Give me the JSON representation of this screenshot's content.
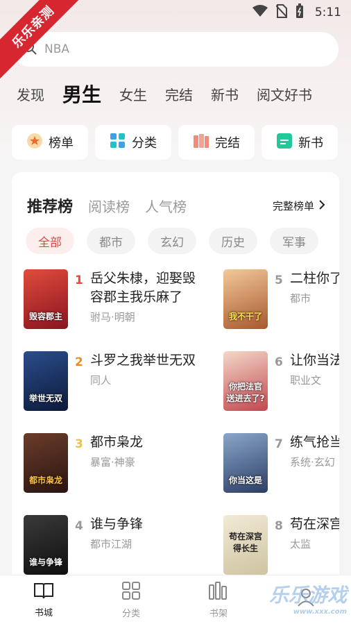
{
  "status": {
    "time": "5:11"
  },
  "badge": "乐乐亲测",
  "search": {
    "placeholder": "NBA"
  },
  "tabs": [
    "发现",
    "男生",
    "女生",
    "完结",
    "新书",
    "阅文好书"
  ],
  "active_tab": "男生",
  "quick": [
    {
      "label": "榜单",
      "icon": "medal-icon"
    },
    {
      "label": "分类",
      "icon": "grid-icon"
    },
    {
      "label": "完结",
      "icon": "books-icon"
    },
    {
      "label": "新书",
      "icon": "new-book-icon"
    }
  ],
  "ranking": {
    "tabs": [
      "推荐榜",
      "阅读榜",
      "人气榜"
    ],
    "full_list": "完整榜单",
    "chips": [
      "全部",
      "都市",
      "玄幻",
      "历史",
      "军事"
    ]
  },
  "books": [
    {
      "rank": "1",
      "title": "岳父朱棣，迎娶毁容郡主我乐麻了",
      "tag": "驸马·明朝",
      "cover_text": "毁容郡主"
    },
    {
      "rank": "2",
      "title": "斗罗之我举世无双",
      "tag": "同人",
      "cover_text": "举世无双"
    },
    {
      "rank": "3",
      "title": "都市枭龙",
      "tag": "暴富·神豪",
      "cover_text": "都市枭龙"
    },
    {
      "rank": "4",
      "title": "谁与争锋",
      "tag": "都市江湖",
      "cover_text": "谁与争锋"
    },
    {
      "rank": "5",
      "title": "二柱你了我吧",
      "tag": "都市",
      "cover_text": "我不干了"
    },
    {
      "rank": "6",
      "title": "让你当法官送",
      "tag": "职业文",
      "cover_text": "你把法官送进去了?"
    },
    {
      "rank": "7",
      "title": "练气抢当这是",
      "tag": "系统·玄幻",
      "cover_text": "你当这是"
    },
    {
      "rank": "8",
      "title": "苟在深宫",
      "tag": "太监",
      "cover_text": "苟在深宫得长生"
    }
  ],
  "nav": [
    {
      "label": "书城",
      "icon": "book-open-icon"
    },
    {
      "label": "分类",
      "icon": "grid-icon"
    },
    {
      "label": "书架",
      "icon": "bookshelf-icon"
    },
    {
      "label": "",
      "icon": "user-icon"
    }
  ],
  "watermark": {
    "main": "乐乐游戏",
    "sub": "www.xxx.com"
  },
  "colors": {
    "accent": "#e4483d",
    "rank_top": "#e4483d",
    "rank_second": "#f08a24",
    "rank_third": "#f5c042",
    "rank_other": "#999999"
  }
}
